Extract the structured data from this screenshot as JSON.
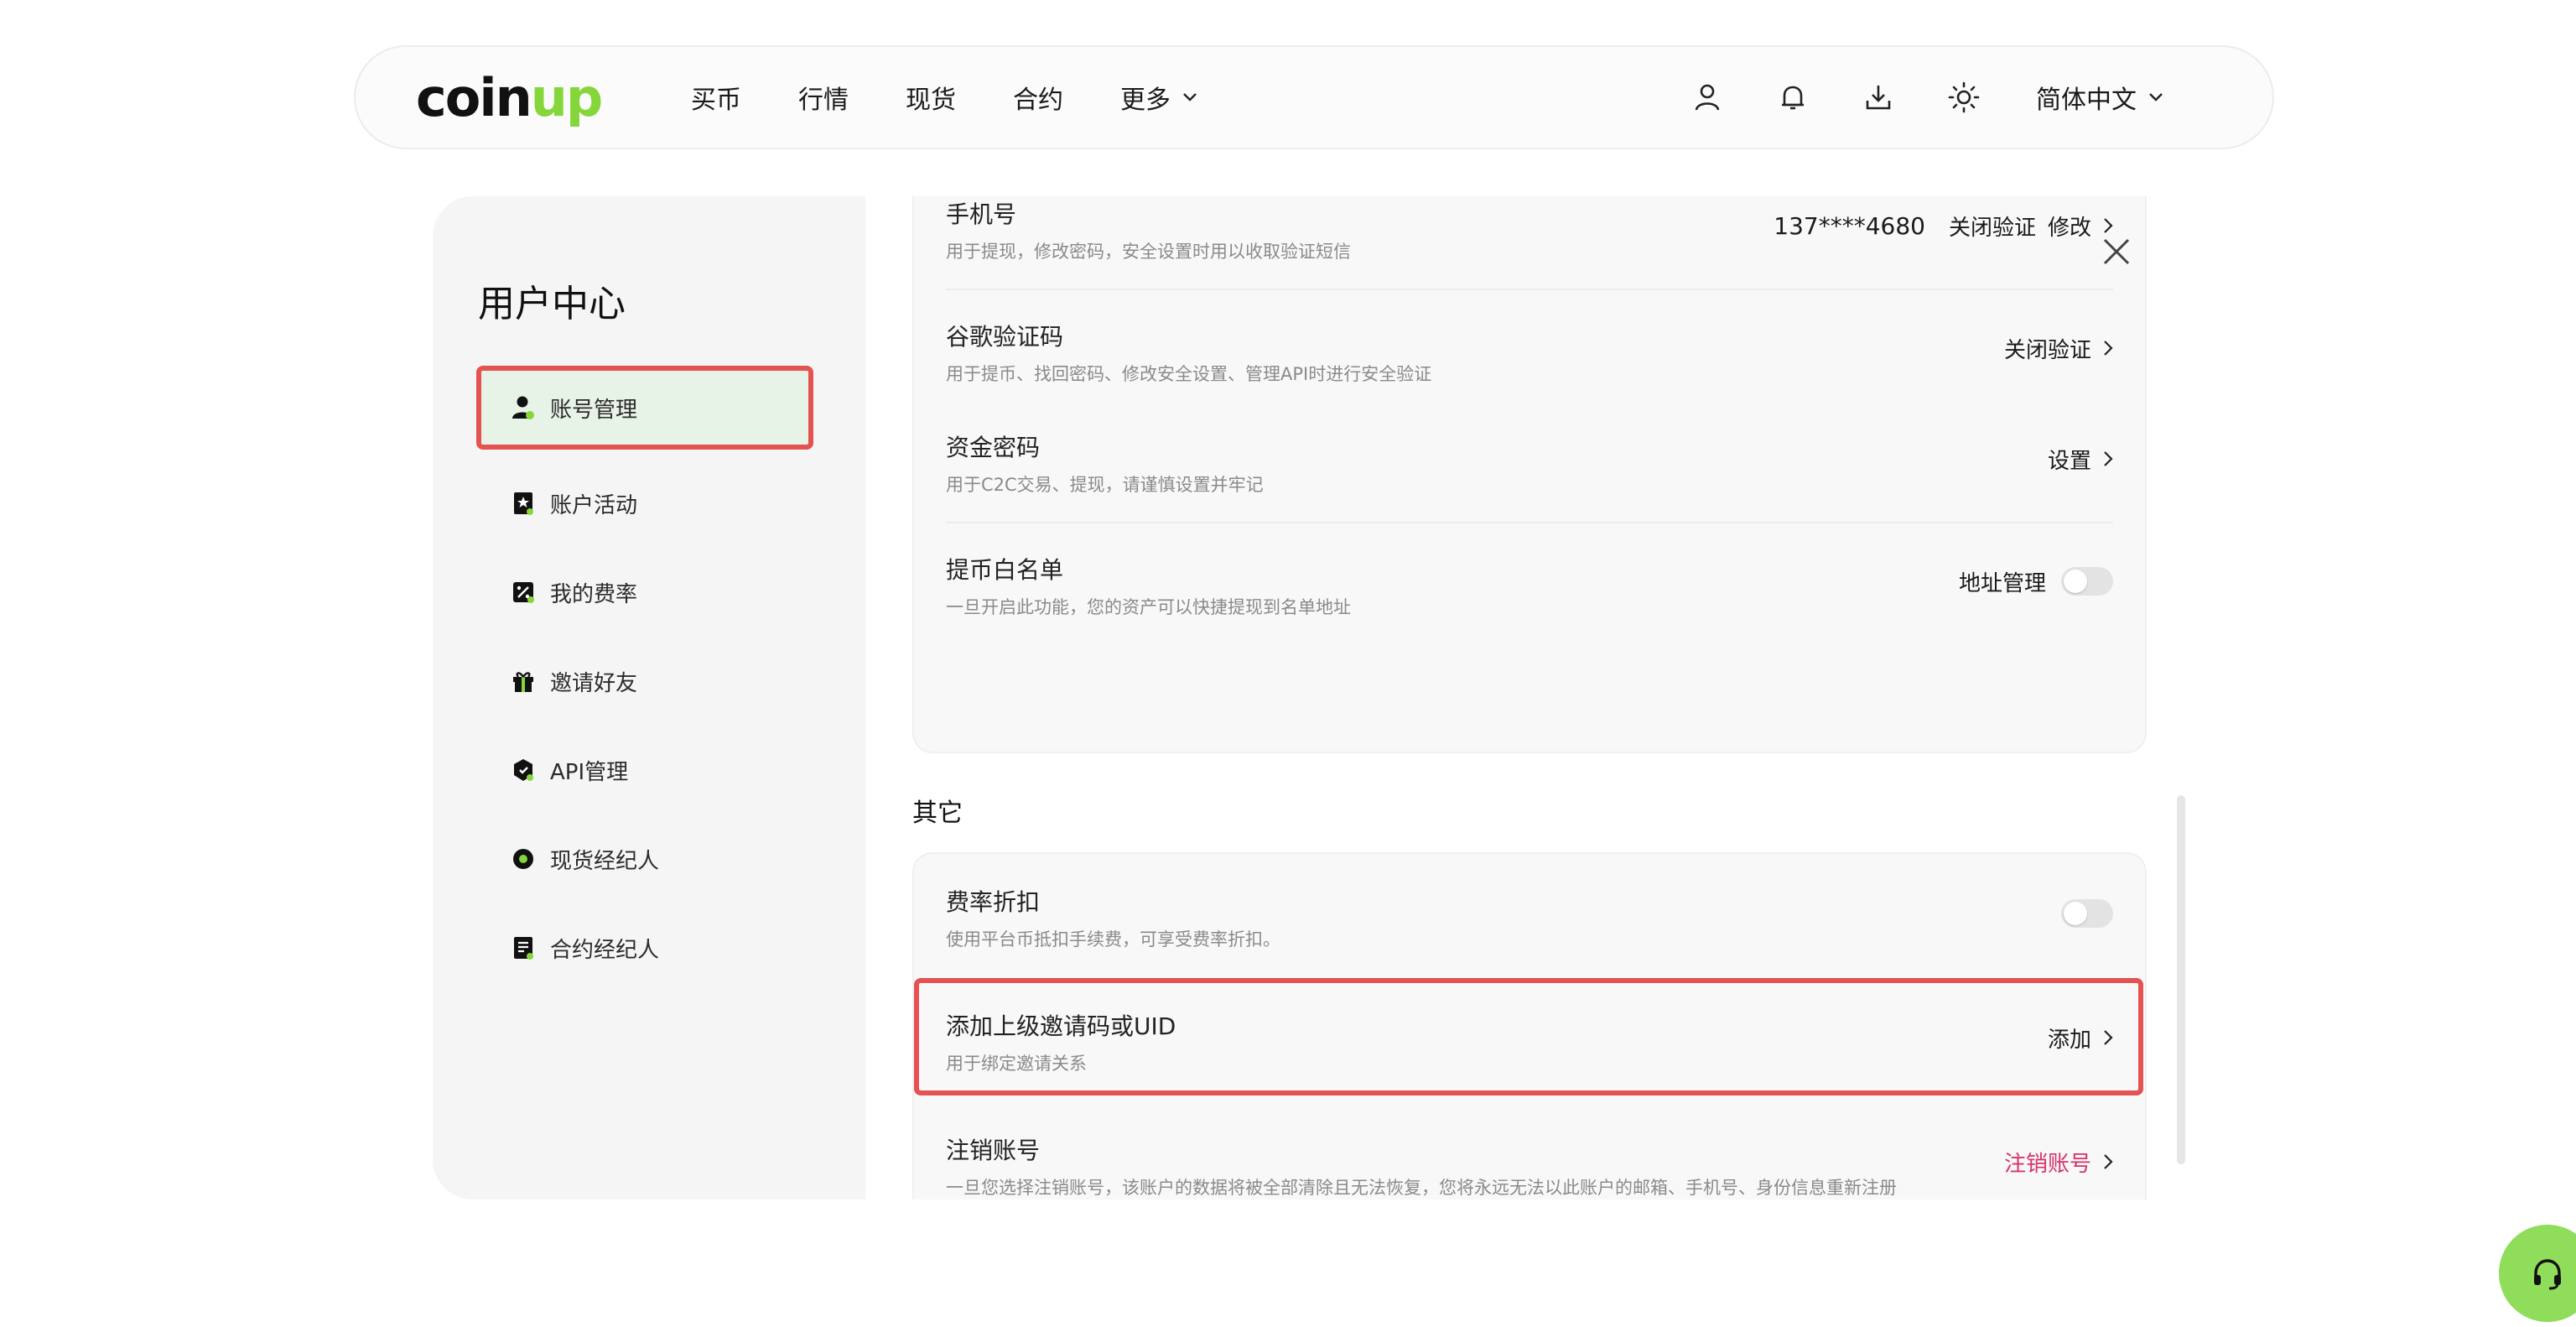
{
  "logo": {
    "text_main": "coin",
    "text_accent": "up"
  },
  "nav": {
    "links": [
      "买币",
      "行情",
      "现货",
      "合约",
      "更多"
    ],
    "language": "简体中文"
  },
  "icons": {
    "user": "user-icon",
    "bell": "bell-icon",
    "download": "download-icon",
    "theme": "sun-icon",
    "close": "close-icon",
    "support": "headset-icon"
  },
  "colors": {
    "accent": "#84d63a",
    "highlight": "#e55252",
    "danger": "#d6336c"
  },
  "sidebar": {
    "title": "用户中心",
    "items": [
      {
        "label": "账号管理",
        "icon": "user-icon",
        "active": true
      },
      {
        "label": "账户活动",
        "icon": "bookmark-icon"
      },
      {
        "label": "我的费率",
        "icon": "percent-icon"
      },
      {
        "label": "邀请好友",
        "icon": "gift-icon"
      },
      {
        "label": "API管理",
        "icon": "api-icon"
      },
      {
        "label": "现货经纪人",
        "icon": "spot-broker-icon"
      },
      {
        "label": "合约经纪人",
        "icon": "contract-broker-icon"
      }
    ]
  },
  "security": {
    "phone": {
      "title": "手机号",
      "desc": "用于提现，修改密码，安全设置时用以收取验证短信",
      "value": "137****4680",
      "action1": "关闭验证",
      "action2": "修改"
    },
    "google": {
      "title": "谷歌验证码",
      "desc": "用于提币、找回密码、修改安全设置、管理API时进行安全验证",
      "action": "关闭验证"
    },
    "fund_password": {
      "title": "资金密码",
      "desc": "用于C2C交易、提现，请谨慎设置并牢记",
      "action": "设置"
    },
    "whitelist": {
      "title": "提币白名单",
      "desc": "一旦开启此功能，您的资产可以快捷提现到名单地址",
      "action": "地址管理",
      "enabled": false
    }
  },
  "other": {
    "section_title": "其它",
    "fee_discount": {
      "title": "费率折扣",
      "desc": "使用平台币抵扣手续费，可享受费率折扣。",
      "enabled": false
    },
    "referral": {
      "title": "添加上级邀请码或UID",
      "desc": "用于绑定邀请关系",
      "action": "添加"
    },
    "delete_account": {
      "title": "注销账号",
      "desc": "一旦您选择注销账号，该账户的数据将被全部清除且无法恢复，您将永远无法以此账户的邮箱、手机号、身份信息重新注册",
      "action": "注销账号"
    }
  }
}
